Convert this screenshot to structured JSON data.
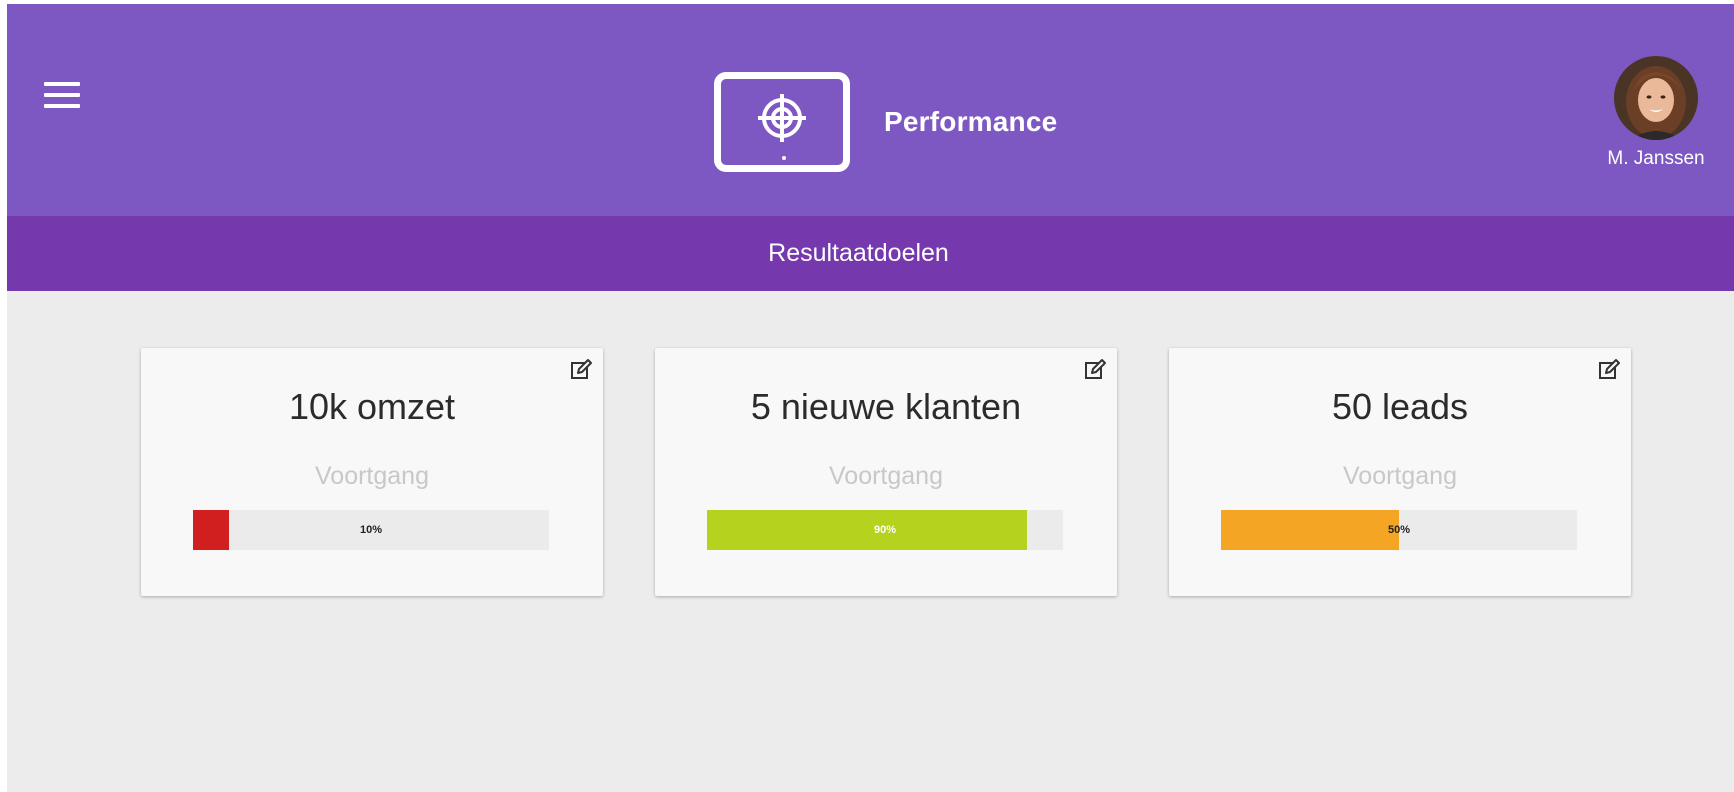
{
  "header": {
    "title": "Performance",
    "menu_icon": "hamburger-menu-icon",
    "logo_icon": "target-monitor-icon",
    "bg_color": "#7e58c2"
  },
  "user": {
    "name": "M. Janssen"
  },
  "subheader": {
    "title": "Resultaatdoelen",
    "bg_color": "#7638ad"
  },
  "goals": [
    {
      "title": "10k omzet",
      "progress_label": "Voortgang",
      "progress": 0.1,
      "progress_text": "10%",
      "color": "#d11f1f",
      "edit_icon": "edit-icon"
    },
    {
      "title": "5 nieuwe klanten",
      "progress_label": "Voortgang",
      "progress": 0.9,
      "progress_text": "90%",
      "color": "#b5d21f",
      "edit_icon": "edit-icon"
    },
    {
      "title": "50 leads",
      "progress_label": "Voortgang",
      "progress": 0.5,
      "progress_text": "50%",
      "color": "#f4a524",
      "edit_icon": "edit-icon"
    }
  ]
}
